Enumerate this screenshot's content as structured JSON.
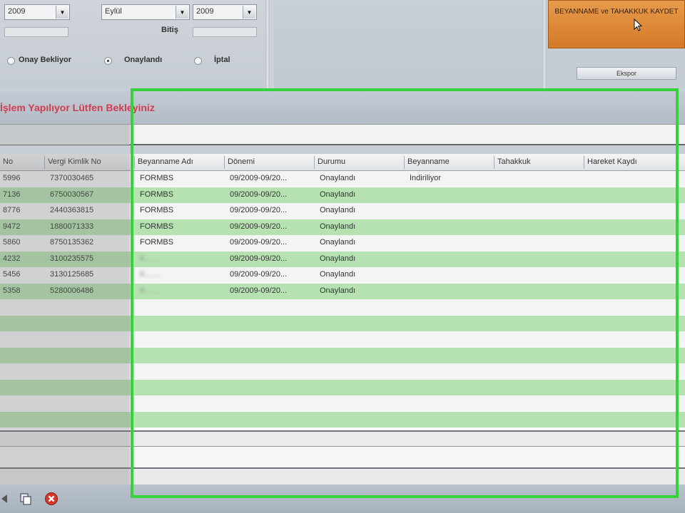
{
  "filters": {
    "year_start": "2009",
    "month_end": "Eylül",
    "year_end": "2009",
    "range_label": "Bitiş",
    "status_options": [
      {
        "label": "Onay Bekliyor",
        "checked": false
      },
      {
        "label": "Onaylandı",
        "checked": true
      },
      {
        "label": "İptal",
        "checked": false
      }
    ]
  },
  "actions": {
    "main_button": "BEYANNAME ve TAHAKKUK KAYDET",
    "small_button": "Ekspor"
  },
  "status_message": "İşlem Yapılıyor Lütfen Bekleyiniz",
  "grid": {
    "columns": [
      "No",
      "Vergi Kimlik No",
      "Beyanname Adı",
      "Dönemi",
      "Durumu",
      "Beyanname",
      "Tahakkuk",
      "Hareket Kaydı"
    ],
    "rows": [
      {
        "no": "5996",
        "vkn": "7370030465",
        "name": "FORMBS",
        "period": "09/2009-09/20...",
        "status": "Onaylandı",
        "beyanname": "İndiriliyor"
      },
      {
        "no": "7136",
        "vkn": "6750030567",
        "name": "FORMBS",
        "period": "09/2009-09/20...",
        "status": "Onaylandı",
        "beyanname": ""
      },
      {
        "no": "8776",
        "vkn": "2440363815",
        "name": "FORMBS",
        "period": "09/2009-09/20...",
        "status": "Onaylandı",
        "beyanname": ""
      },
      {
        "no": "9472",
        "vkn": "1880071333",
        "name": "FORMBS",
        "period": "09/2009-09/20...",
        "status": "Onaylandı",
        "beyanname": ""
      },
      {
        "no": "5860",
        "vkn": "8750135362",
        "name": "FORMBS",
        "period": "09/2009-09/20...",
        "status": "Onaylandı",
        "beyanname": ""
      },
      {
        "no": "4232",
        "vkn": "3100235575",
        "name": "K.......",
        "period": "09/2009-09/20...",
        "status": "Onaylandı",
        "beyanname": ""
      },
      {
        "no": "5456",
        "vkn": "3130125685",
        "name": "K.......",
        "period": "09/2009-09/20...",
        "status": "Onaylandı",
        "beyanname": ""
      },
      {
        "no": "5358",
        "vkn": "5280006486",
        "name": "K.......",
        "period": "09/2009-09/20...",
        "status": "Onaylandı",
        "beyanname": ""
      }
    ]
  },
  "colors": {
    "highlight": "#35d23e",
    "status_red": "#d23c52",
    "row_green": "#b6e2b2",
    "orange_button": "#e08a3a"
  }
}
